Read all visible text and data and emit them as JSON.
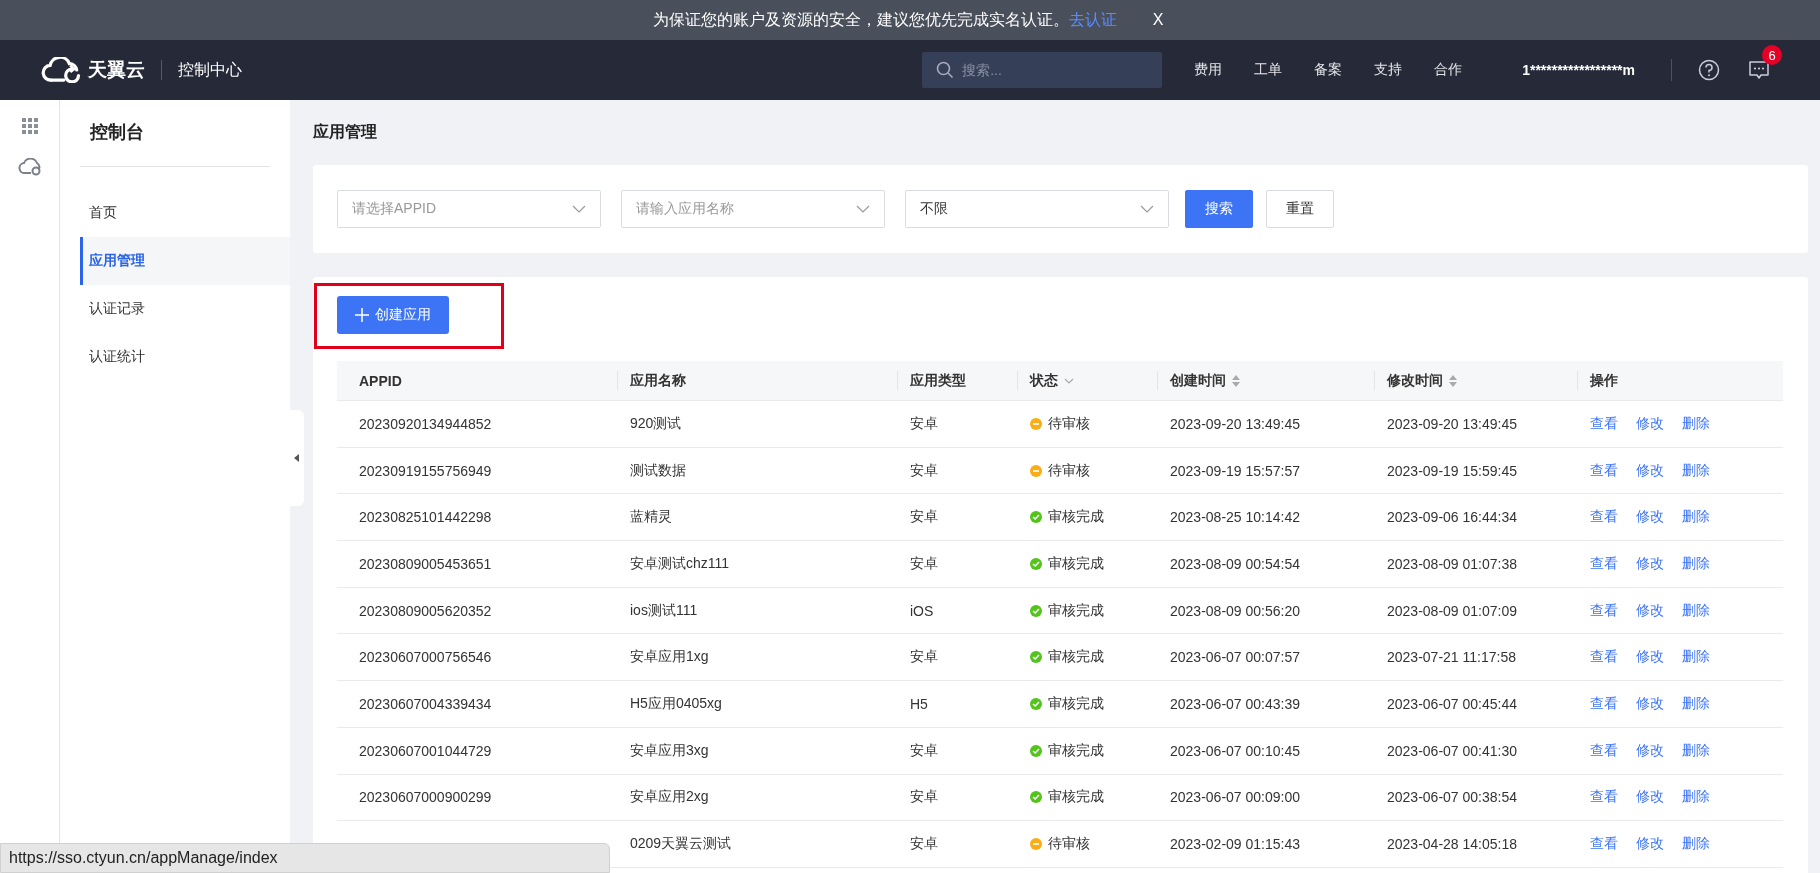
{
  "banner": {
    "message": "为保证您的账户及资源的安全，建议您优先完成实名认证。",
    "link": "去认证",
    "close": "X"
  },
  "topbar": {
    "logo": "天翼云",
    "product": "控制中心",
    "search_placeholder": "搜索...",
    "menu": [
      "费用",
      "工单",
      "备案",
      "支持",
      "合作"
    ],
    "account": "1*****************m",
    "message_count": "6"
  },
  "sidebar": {
    "title": "控制台",
    "items": [
      {
        "label": "首页",
        "selected": false
      },
      {
        "label": "应用管理",
        "selected": true
      },
      {
        "label": "认证记录",
        "selected": false
      },
      {
        "label": "认证统计",
        "selected": false
      }
    ]
  },
  "page_title": "应用管理",
  "filters": {
    "appid_placeholder": "请选择APPID",
    "name_placeholder": "请输入应用名称",
    "status_value": "不限",
    "search_button": "搜索",
    "reset_button": "重置"
  },
  "create_button": "创建应用",
  "table": {
    "columns": [
      {
        "label": "APPID",
        "kind": "plain"
      },
      {
        "label": "应用名称",
        "kind": "plain"
      },
      {
        "label": "应用类型",
        "kind": "plain"
      },
      {
        "label": "状态",
        "kind": "filter"
      },
      {
        "label": "创建时间",
        "kind": "sortable"
      },
      {
        "label": "修改时间",
        "kind": "sortable"
      },
      {
        "label": "操作",
        "kind": "plain"
      }
    ],
    "rows": [
      {
        "appid": "20230920134944852",
        "name": "920测试",
        "type": "安卓",
        "status": "待审核",
        "kind": "pending",
        "created": "2023-09-20 13:49:45",
        "modified": "2023-09-20 13:49:45",
        "actions": [
          "查看",
          "修改",
          "删除"
        ]
      },
      {
        "appid": "20230919155756949",
        "name": "测试数据",
        "type": "安卓",
        "status": "待审核",
        "kind": "pending",
        "created": "2023-09-19 15:57:57",
        "modified": "2023-09-19 15:59:45",
        "actions": [
          "查看",
          "修改",
          "删除"
        ]
      },
      {
        "appid": "20230825101442298",
        "name": "蓝精灵",
        "type": "安卓",
        "status": "审核完成",
        "kind": "done",
        "created": "2023-08-25 10:14:42",
        "modified": "2023-09-06 16:44:34",
        "actions": [
          "查看",
          "修改",
          "删除"
        ]
      },
      {
        "appid": "20230809005453651",
        "name": "安卓测试chz111",
        "type": "安卓",
        "status": "审核完成",
        "kind": "done",
        "created": "2023-08-09 00:54:54",
        "modified": "2023-08-09 01:07:38",
        "actions": [
          "查看",
          "修改",
          "删除"
        ]
      },
      {
        "appid": "20230809005620352",
        "name": "ios测试111",
        "type": "iOS",
        "status": "审核完成",
        "kind": "done",
        "created": "2023-08-09 00:56:20",
        "modified": "2023-08-09 01:07:09",
        "actions": [
          "查看",
          "修改",
          "删除"
        ]
      },
      {
        "appid": "20230607000756546",
        "name": "安卓应用1xg",
        "type": "安卓",
        "status": "审核完成",
        "kind": "done",
        "created": "2023-06-07 00:07:57",
        "modified": "2023-07-21 11:17:58",
        "actions": [
          "查看",
          "修改",
          "删除"
        ]
      },
      {
        "appid": "20230607004339434",
        "name": "H5应用0405xg",
        "type": "H5",
        "status": "审核完成",
        "kind": "done",
        "created": "2023-06-07 00:43:39",
        "modified": "2023-06-07 00:45:44",
        "actions": [
          "查看",
          "修改",
          "删除"
        ]
      },
      {
        "appid": "20230607001044729",
        "name": "安卓应用3xg",
        "type": "安卓",
        "status": "审核完成",
        "kind": "done",
        "created": "2023-06-07 00:10:45",
        "modified": "2023-06-07 00:41:30",
        "actions": [
          "查看",
          "修改",
          "删除"
        ]
      },
      {
        "appid": "20230607000900299",
        "name": "安卓应用2xg",
        "type": "安卓",
        "status": "审核完成",
        "kind": "done",
        "created": "2023-06-07 00:09:00",
        "modified": "2023-06-07 00:38:54",
        "actions": [
          "查看",
          "修改",
          "删除"
        ]
      },
      {
        "name": "0209天翼云测试",
        "type": "安卓",
        "status": "待审核",
        "kind": "pending",
        "created": "2023-02-09 01:15:43",
        "modified": "2023-04-28 14:05:18",
        "actions": [
          "查看",
          "修改",
          "删除"
        ]
      }
    ]
  },
  "status_tooltip": "https://sso.ctyun.cn/appManage/index"
}
